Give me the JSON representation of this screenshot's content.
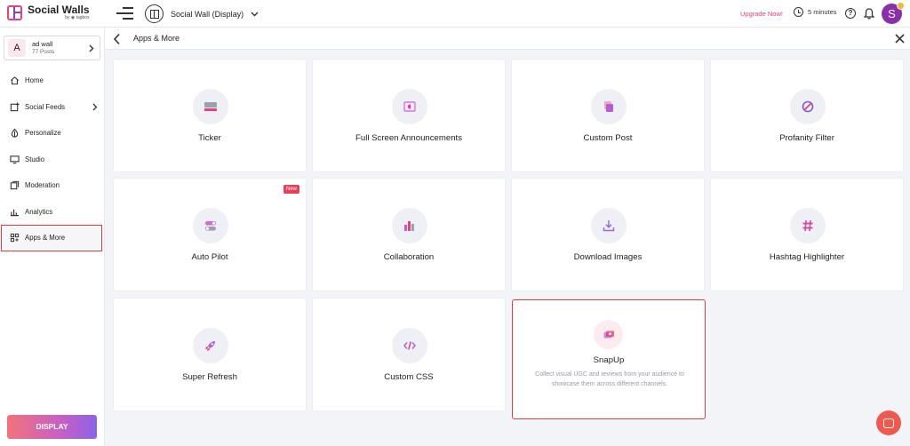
{
  "brand": {
    "name": "Social Walls",
    "sub": "by ◉ tagbox"
  },
  "topbar": {
    "wall_name": "Social Wall (Display)",
    "upgrade": "Upgrade Now!",
    "timer": "5 minutes",
    "avatar_letter": "S"
  },
  "sidebar": {
    "wall_card": {
      "letter": "A",
      "name": "ad wall",
      "count": "77 Posts"
    },
    "items": [
      {
        "label": "Home",
        "icon": "home-icon"
      },
      {
        "label": "Social Feeds",
        "icon": "add-feed-icon"
      },
      {
        "label": "Personalize",
        "icon": "palette-drop-icon"
      },
      {
        "label": "Studio",
        "icon": "monitor-icon"
      },
      {
        "label": "Moderation",
        "icon": "moderation-icon"
      },
      {
        "label": "Analytics",
        "icon": "analytics-icon"
      },
      {
        "label": "Apps & More",
        "icon": "apps-icon"
      }
    ],
    "display_button": "DISPLAY"
  },
  "page": {
    "title": "Apps & More"
  },
  "cards": [
    {
      "title": "Ticker",
      "icon": "ticker-icon"
    },
    {
      "title": "Full Screen Announcements",
      "icon": "announcement-icon"
    },
    {
      "title": "Custom Post",
      "icon": "custom-post-icon"
    },
    {
      "title": "Profanity Filter",
      "icon": "profanity-filter-icon"
    },
    {
      "title": "Auto Pilot",
      "icon": "auto-pilot-icon",
      "badge": "New"
    },
    {
      "title": "Collaboration",
      "icon": "collaboration-icon"
    },
    {
      "title": "Download Images",
      "icon": "download-icon"
    },
    {
      "title": "Hashtag Highlighter",
      "icon": "hashtag-icon"
    },
    {
      "title": "Super Refresh",
      "icon": "rocket-icon"
    },
    {
      "title": "Custom CSS",
      "icon": "code-icon"
    },
    {
      "title": "SnapUp",
      "icon": "snapup-icon",
      "description": "Collect visual UGC and reviews from your audience to showcase them across different channels."
    }
  ],
  "colors": {
    "accent": "#e8407a",
    "highlight": "#e23b3b",
    "display_gradient_start": "#f3737a",
    "display_gradient_end": "#8b63e8"
  }
}
